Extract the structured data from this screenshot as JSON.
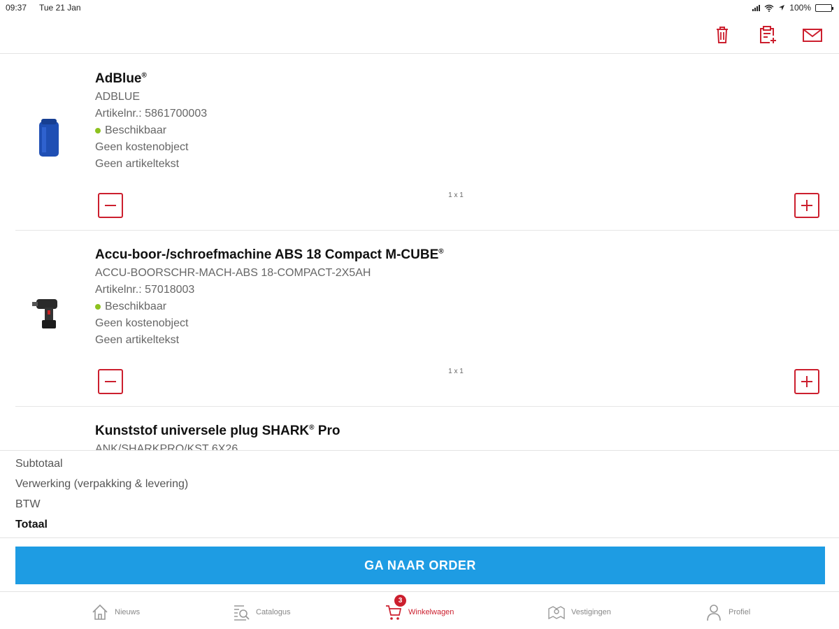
{
  "status_bar": {
    "time": "09:37",
    "date": "Tue 21 Jan",
    "battery": "100%"
  },
  "toolbar": {
    "icons": [
      "trash-icon",
      "clipboard-add-icon",
      "mail-icon"
    ],
    "accent": "#cc1f2e"
  },
  "cart": {
    "items": [
      {
        "title": "AdBlue",
        "title_mark": "®",
        "code": "ADBLUE",
        "article": "Artikelnr.: 5861700003",
        "availability": "Beschikbaar",
        "cost_object": "Geen kostenobject",
        "article_text": "Geen artikeltekst",
        "quantity": "1 x 1"
      },
      {
        "title": "Accu-boor-/schroefmachine ABS 18 Compact M-CUBE",
        "title_mark": "®",
        "code": "ACCU-BOORSCHR-MACH-ABS 18-COMPACT-2X5AH",
        "article": "Artikelnr.: 57018003",
        "availability": "Beschikbaar",
        "cost_object": "Geen kostenobject",
        "article_text": "Geen artikeltekst",
        "quantity": "1 x 1"
      },
      {
        "title_a": "Kunststof universele plug SHARK",
        "title_mark": "®",
        "title_b": " Pro",
        "code": "ANK/SHARKPRO/KST 6X26"
      }
    ]
  },
  "summary": {
    "subtotal_label": "Subtotaal",
    "handling_label": "Verwerking (verpakking & levering)",
    "vat_label": "BTW",
    "total_label": "Totaal"
  },
  "order_button": "GA NAAR ORDER",
  "tabs": {
    "news": "Nieuws",
    "catalog": "Catalogus",
    "cart": "Winkelwagen",
    "cart_badge": "3",
    "locations": "Vestigingen",
    "profile": "Profiel"
  },
  "colors": {
    "brand_red": "#cc1f2e",
    "primary_blue": "#1e9ce3",
    "available_green": "#8dc21f"
  }
}
